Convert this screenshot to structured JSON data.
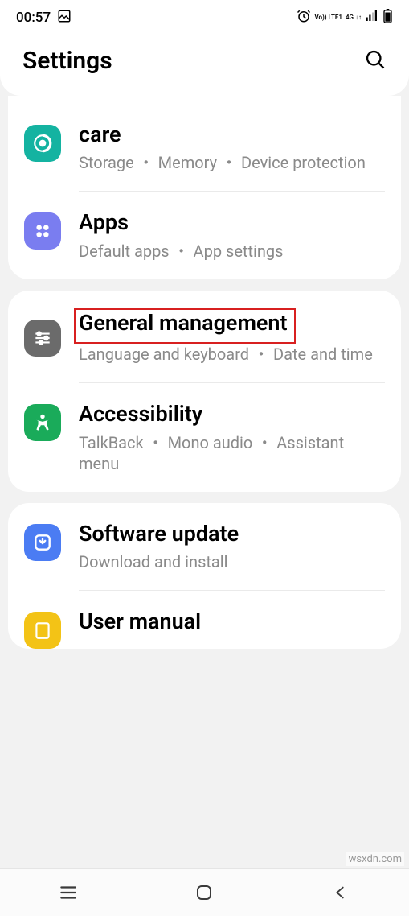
{
  "statusBar": {
    "time": "00:57",
    "volte": "Vo)) LTE1",
    "network": "4G ↓↑"
  },
  "header": {
    "title": "Settings"
  },
  "groups": [
    {
      "items": [
        {
          "id": "care",
          "title": "care",
          "subtitle": "Storage ・ Memory ・ Device protection",
          "iconBg": "bg-teal",
          "iconName": "device-care-icon"
        },
        {
          "id": "apps",
          "title": "Apps",
          "subtitle": "Default apps ・ App settings",
          "iconBg": "bg-purple",
          "iconName": "apps-icon"
        }
      ]
    },
    {
      "items": [
        {
          "id": "general",
          "title": "General management",
          "subtitle": "Language and keyboard ・ Date and time",
          "iconBg": "bg-gray",
          "iconName": "sliders-icon",
          "highlighted": true
        },
        {
          "id": "accessibility",
          "title": "Accessibility",
          "subtitle": "TalkBack ・ Mono audio ・ Assistant menu",
          "iconBg": "bg-green",
          "iconName": "accessibility-icon"
        }
      ]
    },
    {
      "items": [
        {
          "id": "software",
          "title": "Software update",
          "subtitle": "Download and install",
          "iconBg": "bg-blue",
          "iconName": "update-icon"
        },
        {
          "id": "manual",
          "title": "User manual",
          "subtitle": "",
          "iconBg": "bg-yellow",
          "iconName": "manual-icon"
        }
      ]
    }
  ],
  "watermark": "wsxdn.com"
}
